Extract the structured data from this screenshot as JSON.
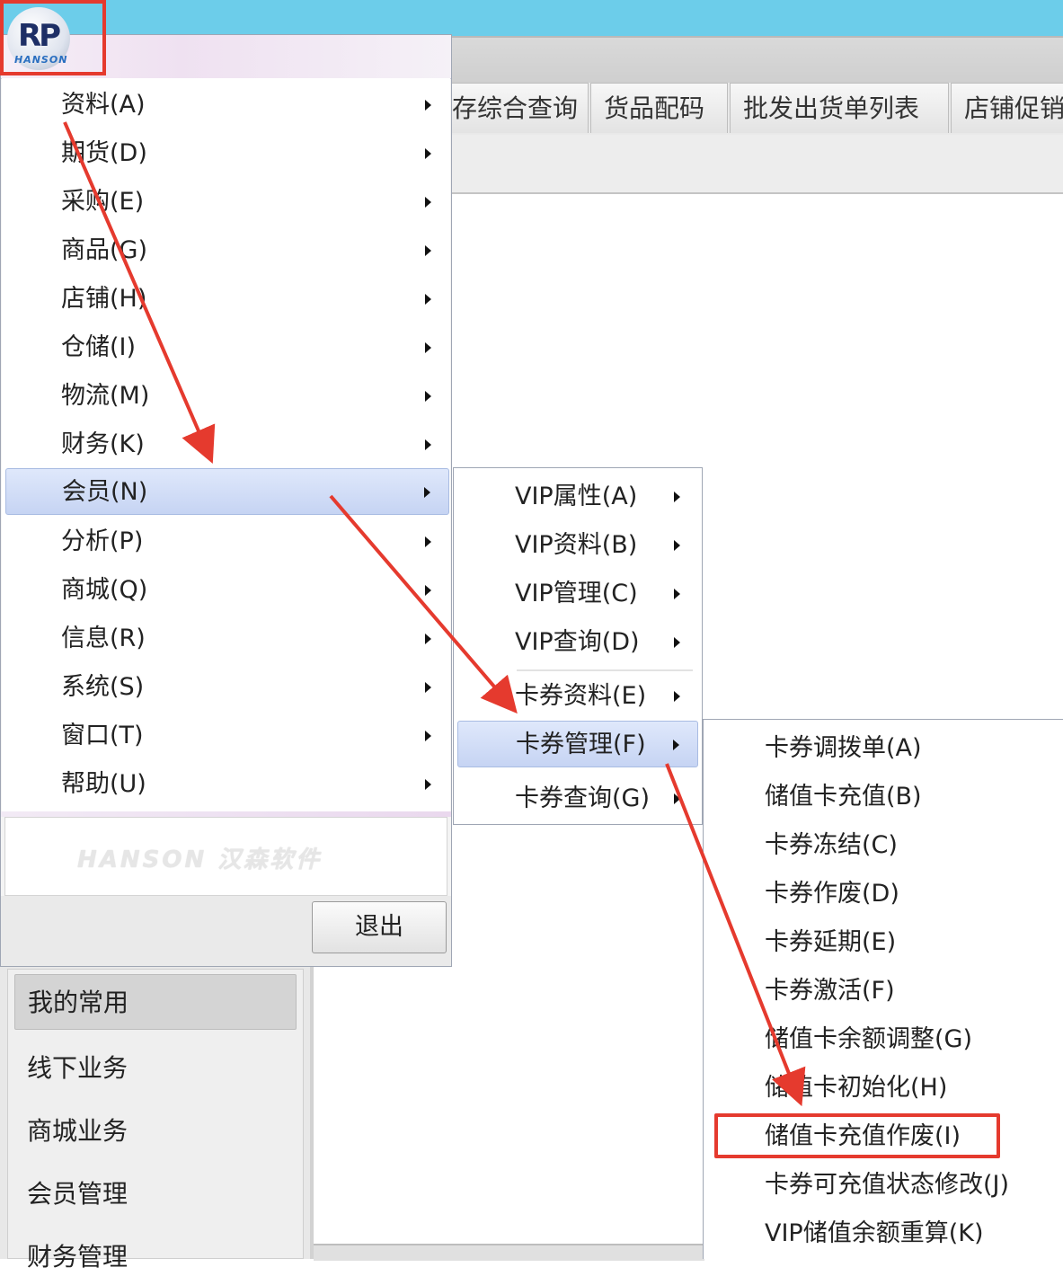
{
  "app": {
    "logo_text": "RP",
    "logo_sub": "HANSON"
  },
  "tabs": [
    {
      "label": "存综合查询"
    },
    {
      "label": "货品配码"
    },
    {
      "label": "批发出货单列表"
    },
    {
      "label": "店铺促销"
    }
  ],
  "left_nav": {
    "items": [
      {
        "label": "我的常用"
      },
      {
        "label": "线下业务"
      },
      {
        "label": "商城业务"
      },
      {
        "label": "会员管理"
      },
      {
        "label": "财务管理"
      }
    ]
  },
  "main_menu": {
    "items": [
      {
        "label": "资料(A)"
      },
      {
        "label": "期货(D)"
      },
      {
        "label": "采购(E)"
      },
      {
        "label": "商品(G)"
      },
      {
        "label": "店铺(H)"
      },
      {
        "label": "仓储(I)"
      },
      {
        "label": "物流(M)"
      },
      {
        "label": "财务(K)"
      },
      {
        "label": "会员(N)"
      },
      {
        "label": "分析(P)"
      },
      {
        "label": "商城(Q)"
      },
      {
        "label": "信息(R)"
      },
      {
        "label": "系统(S)"
      },
      {
        "label": "窗口(T)"
      },
      {
        "label": "帮助(U)"
      }
    ],
    "active_item": "会员(N)",
    "brand_text": "HANSON 汉森软件",
    "exit_label": "退出"
  },
  "member_submenu": {
    "items": [
      {
        "label": "VIP属性(A)"
      },
      {
        "label": "VIP资料(B)"
      },
      {
        "label": "VIP管理(C)"
      },
      {
        "label": "VIP查询(D)"
      },
      {
        "label": "卡券资料(E)"
      },
      {
        "label": "卡券管理(F)"
      },
      {
        "label": "卡券查询(G)"
      }
    ],
    "active_item": "卡券管理(F)"
  },
  "card_submenu": {
    "items": [
      {
        "label": "卡券调拨单(A)"
      },
      {
        "label": "储值卡充值(B)"
      },
      {
        "label": "卡券冻结(C)"
      },
      {
        "label": "卡券作废(D)"
      },
      {
        "label": "卡券延期(E)"
      },
      {
        "label": "卡券激活(F)"
      },
      {
        "label": "储值卡余额调整(G)"
      },
      {
        "label": "储值卡初始化(H)"
      },
      {
        "label": "储值卡充值作废(I)"
      },
      {
        "label": "卡券可充值状态修改(J)"
      },
      {
        "label": "VIP储值余额重算(K)"
      }
    ],
    "highlighted_item": "储值卡充值作废(I)"
  },
  "colors": {
    "annotation_red": "#e53a2e",
    "title_bar": "#6ccdea",
    "menu_highlight": "#c6d4f3"
  }
}
